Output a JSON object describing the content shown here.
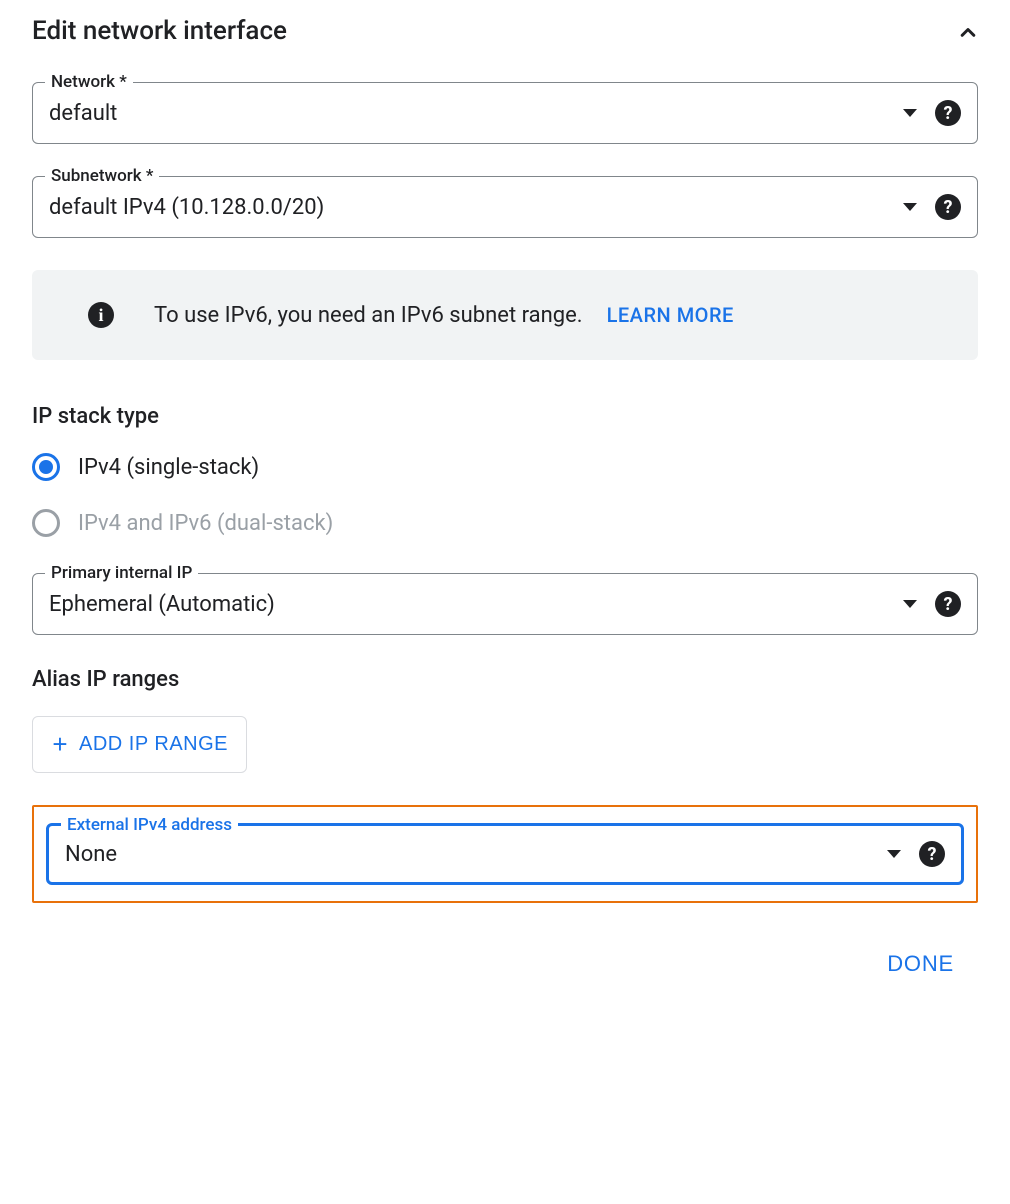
{
  "header": {
    "title": "Edit network interface"
  },
  "network": {
    "label": "Network *",
    "value": "default"
  },
  "subnetwork": {
    "label": "Subnetwork *",
    "value": "default IPv4 (10.128.0.0/20)"
  },
  "info_banner": {
    "text": "To use IPv6, you need an IPv6 subnet range.",
    "learn_more": "LEARN MORE"
  },
  "ip_stack": {
    "heading": "IP stack type",
    "options": {
      "ipv4": "IPv4 (single-stack)",
      "dual": "IPv4 and IPv6 (dual-stack)"
    }
  },
  "primary_ip": {
    "label": "Primary internal IP",
    "value": "Ephemeral (Automatic)"
  },
  "alias_ranges": {
    "heading": "Alias IP ranges",
    "add_button": "ADD IP RANGE"
  },
  "external_ipv4": {
    "label": "External IPv4 address",
    "value": "None"
  },
  "footer": {
    "done": "DONE"
  }
}
